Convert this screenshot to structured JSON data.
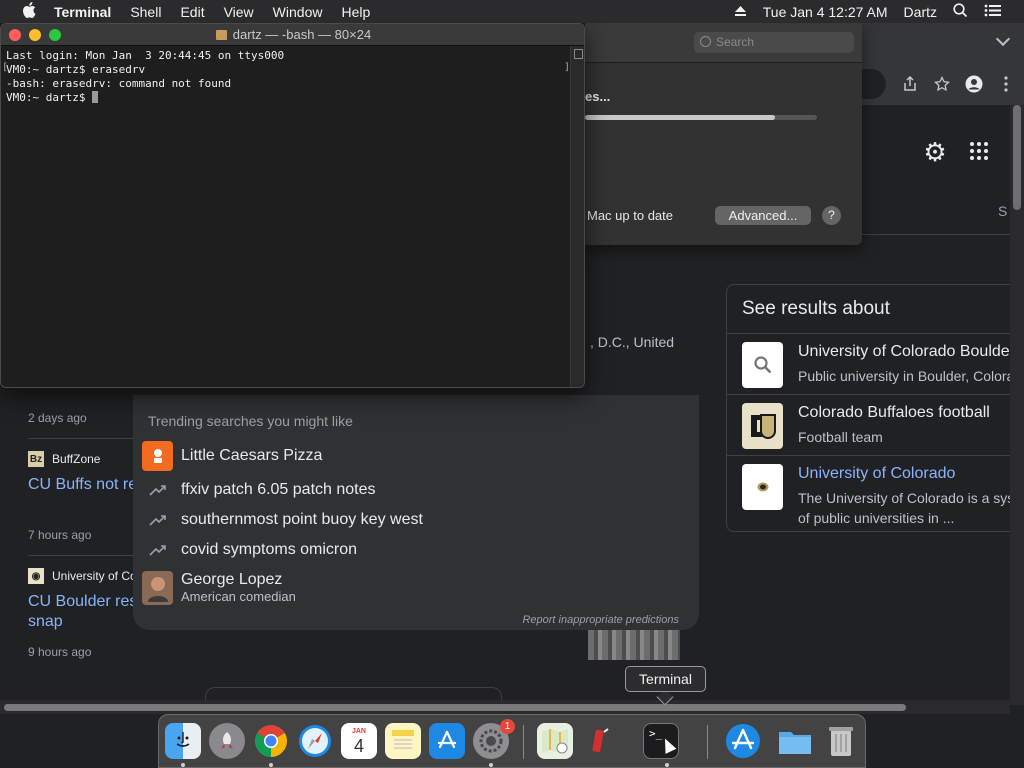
{
  "menubar": {
    "app_name": "Terminal",
    "items": [
      "Shell",
      "Edit",
      "View",
      "Window",
      "Help"
    ],
    "clock": "Tue Jan 4  12:27 AM",
    "user": "Dartz"
  },
  "terminal": {
    "title": "dartz — -bash — 80×24",
    "lines": [
      "Last login: Mon Jan  3 20:44:45 on ttys000",
      "VM0:~ dartz$ erasedrv",
      "-bash: erasedrv: command not found",
      "VM0:~ dartz$ "
    ]
  },
  "sysprefs": {
    "search_placeholder": "Search",
    "status_fragment": "es...",
    "progress_fraction": 0.82,
    "up_to_date_text": "Mac up to date",
    "advanced_label": "Advanced...",
    "help_label": "?"
  },
  "chrome": {
    "s_fragment": "S",
    "location_fragment": ", D.C., United"
  },
  "knowledge_panel": {
    "heading": "See results about",
    "items": [
      {
        "title": "University of Colorado Boulde",
        "subtitle": "Public university in Boulder, Colora"
      },
      {
        "title": "Colorado Buffaloes football",
        "subtitle": "Football team"
      },
      {
        "title": "University of Colorado",
        "subtitle": "The University of Colorado is a sys",
        "subtitle2": "of public universities in ..."
      }
    ]
  },
  "news": {
    "items": [
      {
        "time": "2 days ago"
      },
      {
        "source": "BuffZone",
        "title": "CU Buffs not re",
        "time": "7 hours ago"
      },
      {
        "source": "University of Co",
        "title_line1": "CU Boulder res",
        "title_line2": "snap",
        "time": "9 hours ago"
      }
    ]
  },
  "suggestions": {
    "heading": "Trending searches you might like",
    "items": [
      {
        "label": "Little Caesars Pizza",
        "icon": "little-caesars-logo"
      },
      {
        "label": "ffxiv patch 6.05 patch notes",
        "icon": "trending-icon"
      },
      {
        "label": "southernmost point buoy key west",
        "icon": "trending-icon"
      },
      {
        "label": "covid symptoms omicron",
        "icon": "trending-icon"
      },
      {
        "label": "George Lopez",
        "sublabel": "American comedian",
        "icon": "person-thumbnail"
      }
    ],
    "report_text": "Report inappropriate predictions"
  },
  "tooltip": "Terminal",
  "dock": {
    "calendar_month": "JAN",
    "calendar_day": "4",
    "system_prefs_badge": "1",
    "terminal_glyph": ">_"
  },
  "colors": {
    "link": "#8ab4f8",
    "menubar": "#2b2b2d",
    "page_bg": "#202124",
    "close": "#fe5f57",
    "minimize": "#febc2e",
    "zoom": "#28c840"
  }
}
